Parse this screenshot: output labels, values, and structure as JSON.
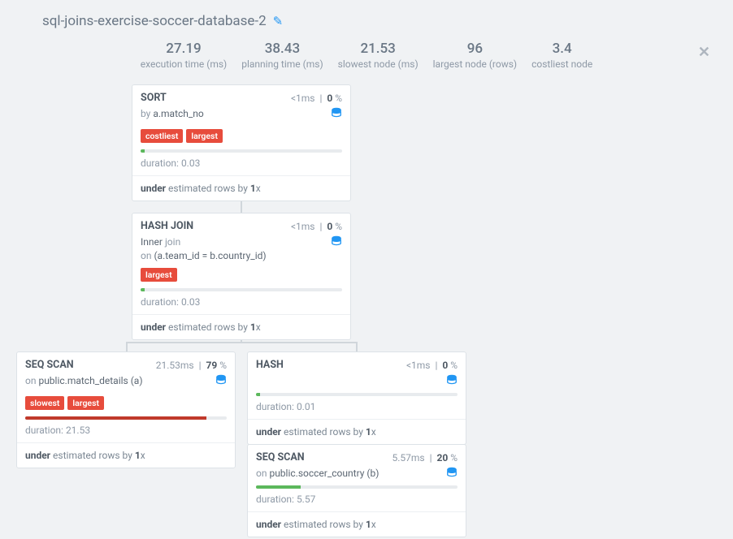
{
  "header": {
    "title": "sql-joins-exercise-soccer-database-2"
  },
  "stats": [
    {
      "value": "27.19",
      "label": "execution time (ms)"
    },
    {
      "value": "38.43",
      "label": "planning time (ms)"
    },
    {
      "value": "21.53",
      "label": "slowest node (ms)"
    },
    {
      "value": "96",
      "label": "largest node (rows)"
    },
    {
      "value": "3.4",
      "label": "costliest node"
    }
  ],
  "nodes": {
    "sort": {
      "title": "SORT",
      "time_html": "<1",
      "time_unit": "ms",
      "pct": "0",
      "sub_prefix": "by ",
      "sub_value": "a.match_no",
      "badges": [
        "costliest",
        "largest"
      ],
      "duration": "duration: 0.03",
      "est_prefix": "under",
      "est_mid": " estimated rows by ",
      "est_factor": "1",
      "est_suffix": "x",
      "bar_pct": 2
    },
    "hashjoin": {
      "title": "HASH JOIN",
      "time_html": "<1",
      "time_unit": "ms",
      "pct": "0",
      "sub_line1_a": "Inner ",
      "sub_line1_b": "join",
      "sub_line2_a": "on ",
      "sub_line2_b": "(a.team_id = b.country_id)",
      "badges": [
        "largest"
      ],
      "duration": "duration: 0.03",
      "est_prefix": "under",
      "est_mid": " estimated rows by ",
      "est_factor": "1",
      "est_suffix": "x",
      "bar_pct": 2
    },
    "seqscan_left": {
      "title": "SEQ SCAN",
      "time_html": "21.53",
      "time_unit": "ms",
      "pct": "79",
      "sub_prefix": "on ",
      "sub_value": "public.match_details (a)",
      "badges": [
        "slowest",
        "largest"
      ],
      "duration": "duration: 21.53",
      "est_prefix": "under",
      "est_mid": " estimated rows by ",
      "est_factor": "1",
      "est_suffix": "x",
      "bar_pct": 90
    },
    "hash": {
      "title": "HASH",
      "time_html": "<1",
      "time_unit": "ms",
      "pct": "0",
      "duration": "duration: 0.01",
      "est_prefix": "under",
      "est_mid": " estimated rows by ",
      "est_factor": "1",
      "est_suffix": "x",
      "bar_pct": 2
    },
    "seqscan_right": {
      "title": "SEQ SCAN",
      "time_html": "5.57",
      "time_unit": "ms",
      "pct": "20",
      "sub_prefix": "on ",
      "sub_value": "public.soccer_country (b)",
      "duration": "duration: 5.57",
      "est_prefix": "under",
      "est_mid": " estimated rows by ",
      "est_factor": "1",
      "est_suffix": "x",
      "bar_pct": 22
    }
  }
}
